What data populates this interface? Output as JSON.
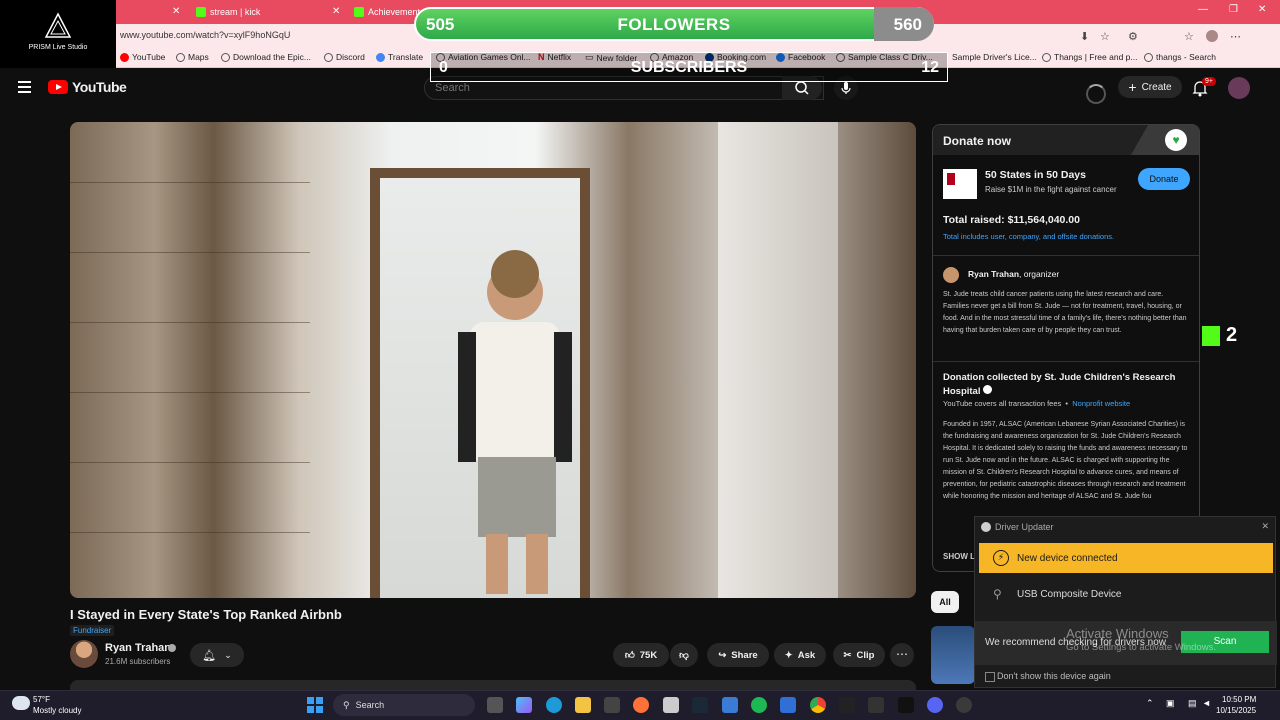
{
  "browser": {
    "tabs": [
      {
        "label": "stream | kick"
      },
      {
        "label": "Achievements"
      }
    ],
    "url": "www.youtube.com/watch?v=xylF9hoNGqU",
    "bookmarks": [
      "YouTube",
      "Maps",
      "Download the Epic...",
      "Discord",
      "Translate",
      "Aviation Games Onl...",
      "Netflix",
      "New folder",
      "Amazon",
      "Booking.com",
      "Facebook",
      "Sample Class C Driv...",
      "Sample Driver's Lice...",
      "Thangs | Free and p...",
      "thangs - Search"
    ]
  },
  "stream_overlay": {
    "app_name": "PRISM Live Studio",
    "followers": {
      "label": "FOLLOWERS",
      "current": "505",
      "goal": "560"
    },
    "subscribers": {
      "label": "SUBSCRIBERS",
      "current": "0",
      "goal": "12"
    },
    "kick_count": "2"
  },
  "youtube": {
    "logo_text": "YouTube",
    "search_placeholder": "Search",
    "create_label": "Create",
    "notification_badge": "9+",
    "video": {
      "title": "I Stayed in Every State's Top Ranked Airbnb",
      "tag": "Fundraiser",
      "channel_name": "Ryan Trahan",
      "channel_subs": "21.6M subscribers",
      "likes": "75K",
      "share_label": "Share",
      "ask_label": "Ask",
      "clip_label": "Clip"
    },
    "chip_all": "All"
  },
  "donate": {
    "header": "Donate now",
    "campaign_name": "50 States in 50 Days",
    "campaign_sub": "Raise $1M in the fight against cancer",
    "donate_button": "Donate",
    "total_raised": "Total raised: $11,564,040.00",
    "total_note": "Total includes user, company, and offsite donations.",
    "organizer_name": "Ryan Trahan",
    "organizer_role": ", organizer",
    "organizer_desc": "St. Jude treats child cancer patients using the latest research and care. Families never get a bill from St. Jude — not for treatment, travel, housing, or food. And in the most stressful time of a family's life, there's nothing better than having that burden taken care of by people they can trust.",
    "collected_by": "Donation collected by St. Jude Children's Research Hospital",
    "fees_note": "YouTube covers all transaction fees",
    "nonprofit_link": "Nonprofit website",
    "founded_text": "Founded in 1957, ALSAC (American Lebanese Syrian Associated Charities) is the fundraising and awareness organization for St. Jude Children's Research Hospital. It is dedicated solely to raising the funds and awareness necessary to run St. Jude now and in the future. ALSAC is charged with supporting the mission of St. Children's Research Hospital to advance cures, and means of prevention, for pediatric catastrophic diseases through research and treatment while honoring the mission and heritage of ALSAC and St. Jude fou",
    "show_less": "SHOW L"
  },
  "driver_updater": {
    "title": "Driver Updater",
    "banner": "New device connected",
    "device": "USB Composite Device",
    "recommend": "We recommend checking for drivers now",
    "scan_button": "Scan",
    "dont_show": "Don't show this device again"
  },
  "activate_windows": {
    "line1": "Activate Windows",
    "line2": "Go to Settings to activate Windows."
  },
  "taskbar": {
    "temp": "57°F",
    "weather": "Mostly cloudy",
    "search_label": "Search",
    "time": "10:50 PM",
    "date": "10/15/2025"
  }
}
